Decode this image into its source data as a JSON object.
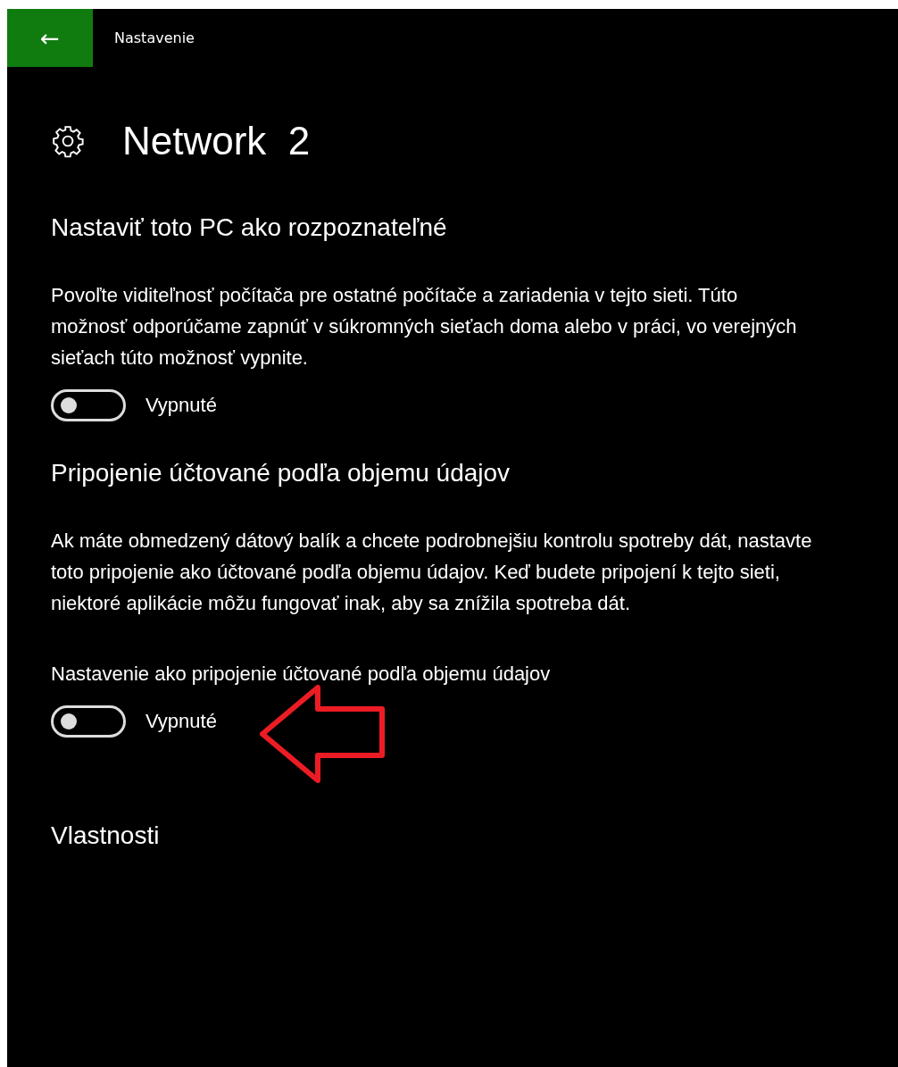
{
  "title_bar": {
    "back_button": "←",
    "title": "Nastavenie"
  },
  "page": {
    "title": "Network  2"
  },
  "sections": [
    {
      "kind": "toggle",
      "heading": "Nastaviť toto PC ako rozpoznateľné",
      "description": "Povoľte viditeľnosť počítača pre ostatné počítače a zariadenia v tejto sieti. Túto možnosť odporúčame zapnúť v súkromných sieťach doma alebo v práci, vo verejných sieťach túto možnosť vypnite.",
      "toggle": {
        "on": false,
        "state_label": "Vypnuté"
      }
    },
    {
      "kind": "toggle",
      "heading": "Pripojenie účtované podľa objemu údajov",
      "description": "Ak máte obmedzený dátový balík a chcete podrobnejšiu kontrolu spotreby dát, nastavte toto pripojenie ako účtované podľa objemu údajov. Keď budete pripojení k tejto sieti, niektoré aplikácie môžu fungovať inak, aby sa znížila spotreba dát.",
      "toggle_label": "Nastavenie ako pripojenie účtované podľa objemu údajov",
      "toggle": {
        "on": false,
        "state_label": "Vypnuté"
      }
    },
    {
      "kind": "heading",
      "heading": "Vlastnosti"
    }
  ]
}
